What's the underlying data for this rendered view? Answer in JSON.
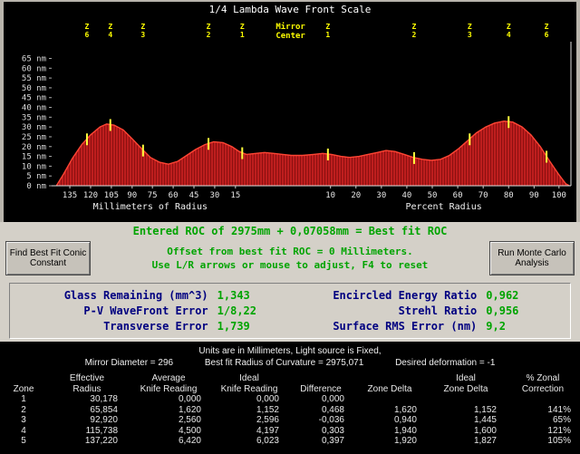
{
  "window": {
    "title": "1/4 Lambda Wave Front Scale"
  },
  "chart_data": {
    "type": "area",
    "title": "1/4 Lambda Wave Front Scale",
    "y_unit": "nm",
    "y_ticks": [
      65,
      60,
      55,
      50,
      45,
      40,
      35,
      30,
      25,
      20,
      15,
      10,
      5,
      0
    ],
    "ylim": [
      0,
      68
    ],
    "x_left_axis": {
      "label": "Millimeters of Radius",
      "label_pos": 0.19,
      "ticks": [
        {
          "label": "135",
          "pos": 0.035
        },
        {
          "label": "120",
          "pos": 0.075
        },
        {
          "label": "105",
          "pos": 0.115
        },
        {
          "label": "90",
          "pos": 0.155
        },
        {
          "label": "75",
          "pos": 0.194
        },
        {
          "label": "60",
          "pos": 0.234
        },
        {
          "label": "45",
          "pos": 0.274
        },
        {
          "label": "30",
          "pos": 0.314
        },
        {
          "label": "15",
          "pos": 0.354
        }
      ]
    },
    "x_right_axis": {
      "label": "Percent Radius",
      "label_pos": 0.755,
      "ticks": [
        {
          "label": "10",
          "pos": 0.537
        },
        {
          "label": "20",
          "pos": 0.586
        },
        {
          "label": "30",
          "pos": 0.635
        },
        {
          "label": "40",
          "pos": 0.684
        },
        {
          "label": "50",
          "pos": 0.733
        },
        {
          "label": "60",
          "pos": 0.782
        },
        {
          "label": "70",
          "pos": 0.831
        },
        {
          "label": "80",
          "pos": 0.88
        },
        {
          "label": "90",
          "pos": 0.929
        },
        {
          "label": "100",
          "pos": 0.977
        }
      ]
    },
    "zones_left": [
      {
        "label": "Z6",
        "pos": 0.068
      },
      {
        "label": "Z4",
        "pos": 0.113
      },
      {
        "label": "Z3",
        "pos": 0.176
      },
      {
        "label": "Z2",
        "pos": 0.302
      },
      {
        "label": "Z1",
        "pos": 0.367
      }
    ],
    "zones_right": [
      {
        "label": "Z1",
        "pos": 0.532
      },
      {
        "label": "Z2",
        "pos": 0.698
      },
      {
        "label": "Z3",
        "pos": 0.805
      },
      {
        "label": "Z4",
        "pos": 0.88
      },
      {
        "label": "Z6",
        "pos": 0.953
      }
    ],
    "center_label": "Mirror Center",
    "center_position": 0.46,
    "series_name": "wavefront error",
    "profile": [
      [
        0.009,
        0
      ],
      [
        0.023,
        6
      ],
      [
        0.04,
        14
      ],
      [
        0.058,
        21
      ],
      [
        0.075,
        26
      ],
      [
        0.093,
        30
      ],
      [
        0.106,
        31.5
      ],
      [
        0.12,
        31
      ],
      [
        0.138,
        28.5
      ],
      [
        0.155,
        24
      ],
      [
        0.173,
        19
      ],
      [
        0.19,
        14.5
      ],
      [
        0.208,
        12
      ],
      [
        0.225,
        11
      ],
      [
        0.243,
        12.5
      ],
      [
        0.26,
        15.5
      ],
      [
        0.277,
        18.5
      ],
      [
        0.295,
        21
      ],
      [
        0.312,
        22.5
      ],
      [
        0.33,
        22
      ],
      [
        0.347,
        20
      ],
      [
        0.361,
        17.5
      ],
      [
        0.375,
        16
      ],
      [
        0.393,
        16.5
      ],
      [
        0.41,
        17
      ],
      [
        0.428,
        16.5
      ],
      [
        0.445,
        16
      ],
      [
        0.462,
        15.5
      ],
      [
        0.483,
        15.5
      ],
      [
        0.504,
        16
      ],
      [
        0.522,
        16.5
      ],
      [
        0.539,
        16
      ],
      [
        0.557,
        15
      ],
      [
        0.574,
        14.5
      ],
      [
        0.592,
        15
      ],
      [
        0.609,
        16
      ],
      [
        0.627,
        17
      ],
      [
        0.644,
        18
      ],
      [
        0.661,
        17.5
      ],
      [
        0.679,
        16
      ],
      [
        0.696,
        14.5
      ],
      [
        0.714,
        13.5
      ],
      [
        0.731,
        13
      ],
      [
        0.749,
        13.5
      ],
      [
        0.766,
        15.5
      ],
      [
        0.784,
        19
      ],
      [
        0.801,
        23
      ],
      [
        0.818,
        27
      ],
      [
        0.836,
        30
      ],
      [
        0.853,
        32
      ],
      [
        0.871,
        33
      ],
      [
        0.888,
        32.5
      ],
      [
        0.906,
        30
      ],
      [
        0.923,
        26
      ],
      [
        0.941,
        20
      ],
      [
        0.958,
        13
      ],
      [
        0.976,
        6
      ],
      [
        0.99,
        1
      ],
      [
        0.997,
        0
      ]
    ],
    "fill_color": "#8c1010",
    "comb_color": "#d42424",
    "line_color": "#ff4534",
    "marker_color": "#ffff3c"
  },
  "roc_panel": {
    "entered_roc": "Entered ROC of 2975mm + 0,07058mm = Best fit ROC",
    "offset_line": "Offset from best fit ROC = 0 Millimeters.",
    "hint_line": "Use L/R arrows or mouse to adjust, F4 to reset",
    "find_button": "Find Best Fit Conic Constant",
    "monte_carlo_button": "Run Monte Carlo Analysis"
  },
  "stats": {
    "rows": [
      {
        "left_label": "Glass Remaining (mm^3)",
        "left_value": "1,343",
        "right_label": "Encircled Energy Ratio",
        "right_value": "0,962"
      },
      {
        "left_label": "P-V WaveFront Error",
        "left_value": "1/8,22",
        "right_label": "Strehl Ratio",
        "right_value": "0,956"
      },
      {
        "left_label": "Transverse Error",
        "left_value": "1,739",
        "right_label": "Surface RMS Error (nm)",
        "right_value": "9,2"
      }
    ]
  },
  "footer": {
    "units_line": "Units are in Millimeters, Light source is Fixed,",
    "mirror_diameter": "Mirror Diameter = 296",
    "best_fit_roc": "Best fit Radius of Curvature = 2975,071",
    "desired_deformation": "Desired deformation = -1",
    "table": {
      "headers": [
        [
          "",
          "Zone"
        ],
        [
          "Effective",
          "Radius"
        ],
        [
          "Average",
          "Knife Reading"
        ],
        [
          "Ideal",
          "Knife Reading"
        ],
        [
          "",
          "Difference"
        ],
        [
          "",
          "Zone Delta"
        ],
        [
          "Ideal",
          "Zone Delta"
        ],
        [
          "% Zonal",
          "Correction"
        ]
      ],
      "rows": [
        [
          "1",
          "30,178",
          "0,000",
          "0,000",
          "0,000",
          "",
          "",
          ""
        ],
        [
          "2",
          "65,854",
          "1,620",
          "1,152",
          "0,468",
          "1,620",
          "1,152",
          "141%"
        ],
        [
          "3",
          "92,920",
          "2,560",
          "2,596",
          "-0,036",
          "0,940",
          "1,445",
          "65%"
        ],
        [
          "4",
          "115,738",
          "4,500",
          "4,197",
          "0,303",
          "1,940",
          "1,600",
          "121%"
        ],
        [
          "5",
          "137,220",
          "6,420",
          "6,023",
          "0,397",
          "1,920",
          "1,827",
          "105%"
        ]
      ]
    }
  }
}
